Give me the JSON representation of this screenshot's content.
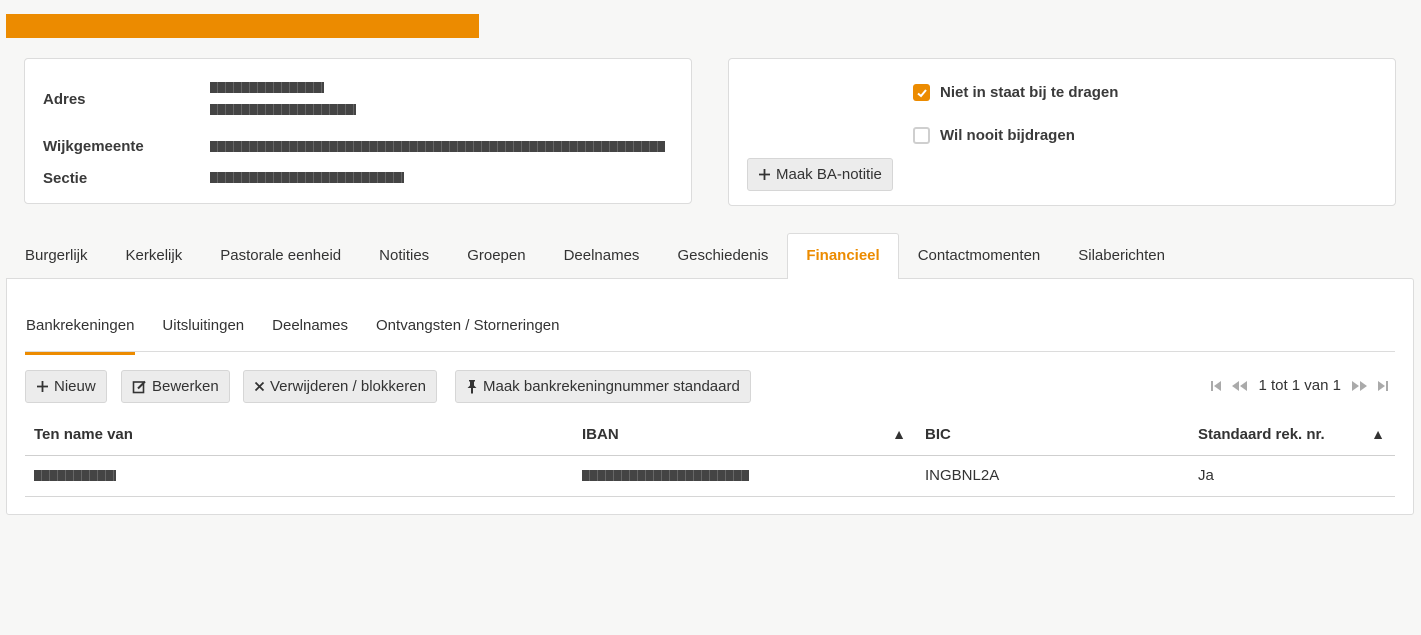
{
  "details": {
    "address_label": "Adres",
    "district_label": "Wijkgemeente",
    "section_label": "Sectie"
  },
  "contribution": {
    "unable_label": "Niet in staat bij te dragen",
    "unable_checked": true,
    "never_label": "Wil nooit bijdragen",
    "never_checked": false,
    "note_button": "Maak BA-notitie"
  },
  "tabs": [
    {
      "label": "Burgerlijk"
    },
    {
      "label": "Kerkelijk"
    },
    {
      "label": "Pastorale eenheid"
    },
    {
      "label": "Notities"
    },
    {
      "label": "Groepen"
    },
    {
      "label": "Deelnames"
    },
    {
      "label": "Geschiedenis"
    },
    {
      "label": "Financieel",
      "active": true
    },
    {
      "label": "Contactmomenten"
    },
    {
      "label": "Silaberichten"
    }
  ],
  "subtabs": [
    {
      "label": "Bankrekeningen",
      "active": true
    },
    {
      "label": "Uitsluitingen"
    },
    {
      "label": "Deelnames"
    },
    {
      "label": "Ontvangsten / Storneringen"
    }
  ],
  "toolbar": {
    "new_label": "Nieuw",
    "edit_label": "Bewerken",
    "delete_label": "Verwijderen / blokkeren",
    "default_label": "Maak bankrekeningnummer standaard"
  },
  "pager": {
    "text": "1 tot 1 van 1"
  },
  "table": {
    "headers": [
      "Ten name van",
      "IBAN",
      "BIC",
      "Standaard rek. nr."
    ],
    "rows": [
      {
        "bic": "INGBNL2A",
        "default": "Ja"
      }
    ]
  },
  "colors": {
    "accent": "#ec8b00"
  }
}
